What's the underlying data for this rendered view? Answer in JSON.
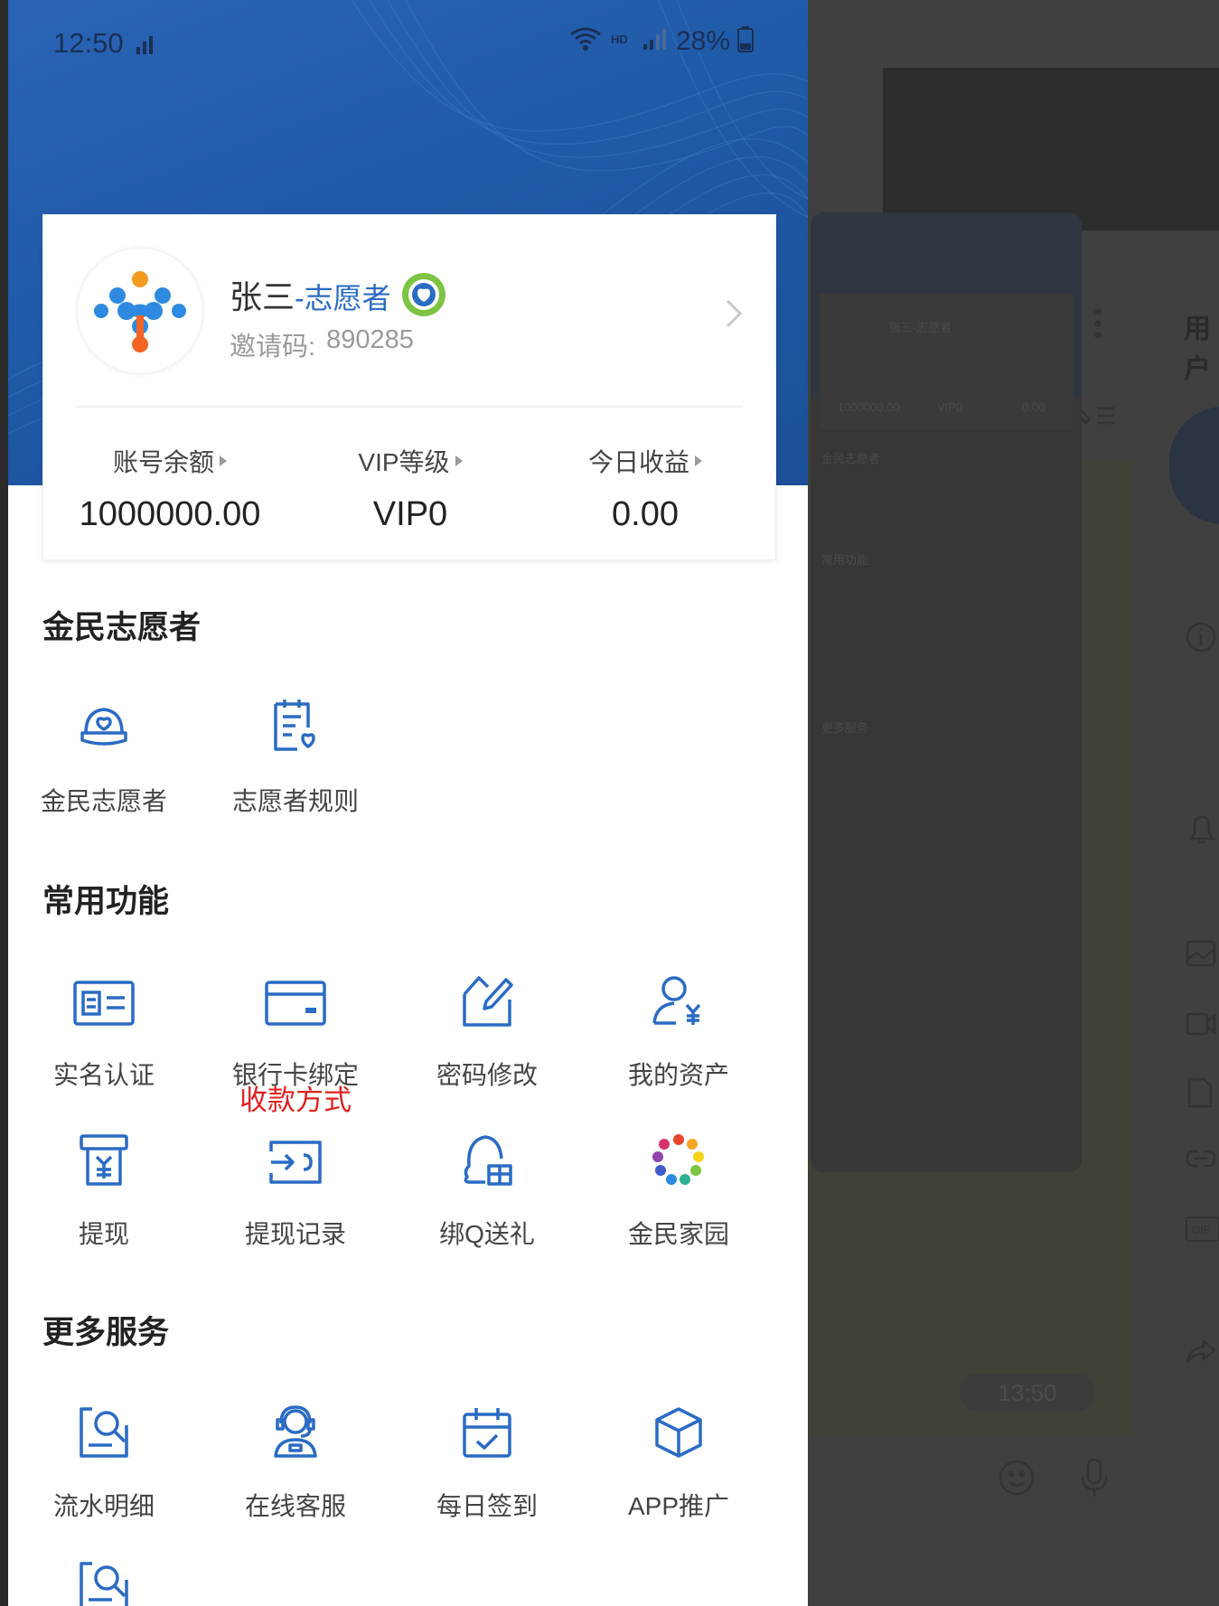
{
  "status_bar": {
    "time": "12:50",
    "battery": "28%"
  },
  "profile": {
    "name": "张三",
    "role": "-志愿者",
    "invite_label": "邀请码:",
    "invite_code": "890285"
  },
  "stats": [
    {
      "label": "账号余额",
      "value": "1000000.00"
    },
    {
      "label": "VIP等级",
      "value": "VIP0"
    },
    {
      "label": "今日收益",
      "value": "0.00"
    }
  ],
  "sections": {
    "volunteer": {
      "title": "金民志愿者",
      "items": [
        "金民志愿者",
        "志愿者规则"
      ]
    },
    "common": {
      "title": "常用功能",
      "items": [
        "实名认证",
        "银行卡绑定",
        "密码修改",
        "我的资产",
        "提现",
        "提现记录",
        "绑Q送礼",
        "金民家园"
      ]
    },
    "more": {
      "title": "更多服务",
      "items": [
        "流水明细",
        "在线客服",
        "每日签到",
        "APP推广"
      ]
    }
  },
  "annotation": "收款方式",
  "background_app": {
    "header_label": "用户",
    "mini_time": "13:50",
    "mini_profile_name": "张三-志愿者",
    "mini_stats": [
      "1000000.00",
      "VIP0",
      "0.00"
    ],
    "mini_sections": [
      "金民志愿者",
      "常用功能",
      "更多服务"
    ]
  },
  "colors": {
    "brand_blue": "#1f5aa8",
    "icon_blue": "#2a6bc4",
    "annotation_red": "#e02020"
  }
}
